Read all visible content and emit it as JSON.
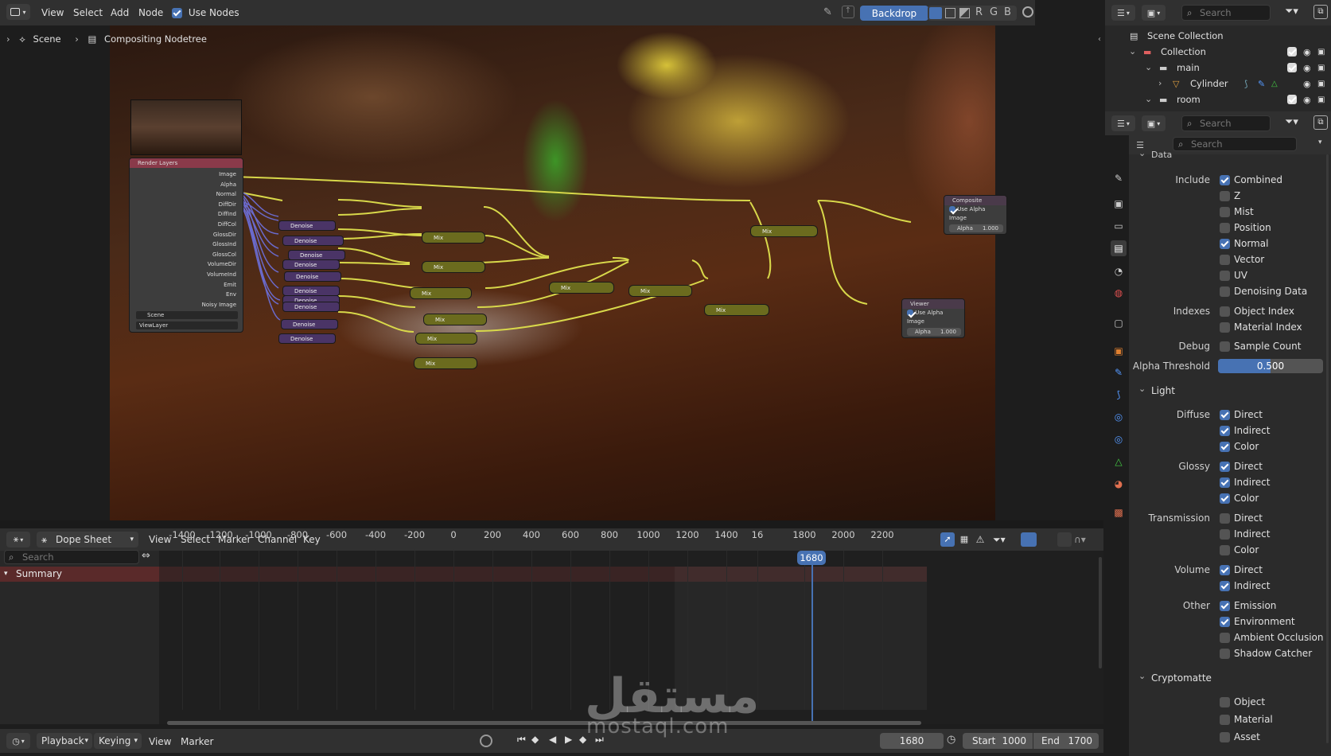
{
  "node_editor": {
    "header": {
      "menus": [
        "View",
        "Select",
        "Add",
        "Node"
      ],
      "use_nodes_label": "Use Nodes",
      "backdrop_label": "Backdrop",
      "channels": [
        "R",
        "G",
        "B"
      ]
    },
    "breadcrumb": {
      "scene": "Scene",
      "tree": "Compositing Nodetree"
    },
    "render_layers_node": {
      "title": "Render Layers",
      "outputs": [
        "Image",
        "Alpha",
        "Normal",
        "DiffDir",
        "DiffInd",
        "DiffCol",
        "GlossDir",
        "GlossInd",
        "GlossCol",
        "VolumeDir",
        "VolumeInd",
        "Emit",
        "Env",
        "Noisy Image"
      ],
      "scene_value": "Scene",
      "layer_value": "ViewLayer"
    },
    "denoise_label": "Denoise",
    "mix_label": "Mix",
    "composite_node": {
      "title": "Composite",
      "use_alpha": "Use Alpha",
      "image": "Image",
      "alpha_label": "Alpha",
      "alpha_value": "1.000"
    },
    "viewer_node": {
      "title": "Viewer",
      "use_alpha": "Use Alpha",
      "image": "Image",
      "alpha_label": "Alpha",
      "alpha_value": "1.000"
    }
  },
  "dope_sheet": {
    "header": {
      "mode": "Dope Sheet",
      "menus": [
        "View",
        "Select",
        "Marker",
        "Channel",
        "Key"
      ]
    },
    "search_placeholder": "Search",
    "summary_label": "Summary",
    "ticks": [
      "-1400",
      "-1200",
      "-1000",
      "-800",
      "-600",
      "-400",
      "-200",
      "0",
      "200",
      "400",
      "600",
      "800",
      "1000",
      "1200",
      "1400",
      "16",
      "1800",
      "2000",
      "2200"
    ],
    "current_frame_badge": "1680"
  },
  "timeline": {
    "menus": [
      "Playback",
      "Keying",
      "View",
      "Marker"
    ],
    "current_frame": "1680",
    "start_label": "Start",
    "start_value": "1000",
    "end_label": "End",
    "end_value": "1700"
  },
  "outliner": {
    "search_placeholder": "Search",
    "items": [
      {
        "label": "Scene Collection"
      },
      {
        "label": "Collection"
      },
      {
        "label": "main"
      },
      {
        "label": "Cylinder"
      },
      {
        "label": "room"
      }
    ]
  },
  "properties": {
    "search_placeholder": "Search",
    "search2_placeholder": "Search",
    "data_section": "Data",
    "include_label": "Include",
    "include": [
      {
        "label": "Combined",
        "checked": true
      },
      {
        "label": "Z",
        "checked": false
      },
      {
        "label": "Mist",
        "checked": false
      },
      {
        "label": "Position",
        "checked": false
      },
      {
        "label": "Normal",
        "checked": true
      },
      {
        "label": "Vector",
        "checked": false
      },
      {
        "label": "UV",
        "checked": false
      },
      {
        "label": "Denoising Data",
        "checked": false
      }
    ],
    "indexes_label": "Indexes",
    "indexes": [
      {
        "label": "Object Index",
        "checked": false
      },
      {
        "label": "Material Index",
        "checked": false
      }
    ],
    "debug_label": "Debug",
    "debug": [
      {
        "label": "Sample Count",
        "checked": false
      }
    ],
    "alpha_threshold_label": "Alpha Threshold",
    "alpha_threshold_value": "0.500",
    "light_section": "Light",
    "diffuse_label": "Diffuse",
    "diffuse": [
      {
        "label": "Direct",
        "checked": true
      },
      {
        "label": "Indirect",
        "checked": true
      },
      {
        "label": "Color",
        "checked": true
      }
    ],
    "glossy_label": "Glossy",
    "glossy": [
      {
        "label": "Direct",
        "checked": true
      },
      {
        "label": "Indirect",
        "checked": true
      },
      {
        "label": "Color",
        "checked": true
      }
    ],
    "transmission_label": "Transmission",
    "transmission": [
      {
        "label": "Direct",
        "checked": false
      },
      {
        "label": "Indirect",
        "checked": false
      },
      {
        "label": "Color",
        "checked": false
      }
    ],
    "volume_label": "Volume",
    "volume": [
      {
        "label": "Direct",
        "checked": true
      },
      {
        "label": "Indirect",
        "checked": true
      }
    ],
    "other_label": "Other",
    "other": [
      {
        "label": "Emission",
        "checked": true
      },
      {
        "label": "Environment",
        "checked": true
      },
      {
        "label": "Ambient Occlusion",
        "checked": false
      },
      {
        "label": "Shadow Catcher",
        "checked": false
      }
    ],
    "cryptomatte_section": "Cryptomatte",
    "cryptomatte": [
      {
        "label": "Object",
        "checked": false
      },
      {
        "label": "Material",
        "checked": false
      },
      {
        "label": "Asset",
        "checked": false
      }
    ]
  },
  "watermark": {
    "arabic": "مستقل",
    "latin": "mostaql.com"
  },
  "colors": {
    "accent": "#4772b3",
    "header": "#303030",
    "panel": "#2b2b2b",
    "denoise_node": "#5a3f7a",
    "mix_node": "#707020",
    "render_layers_header": "#8a3a4a",
    "link": "#d8d84a"
  }
}
